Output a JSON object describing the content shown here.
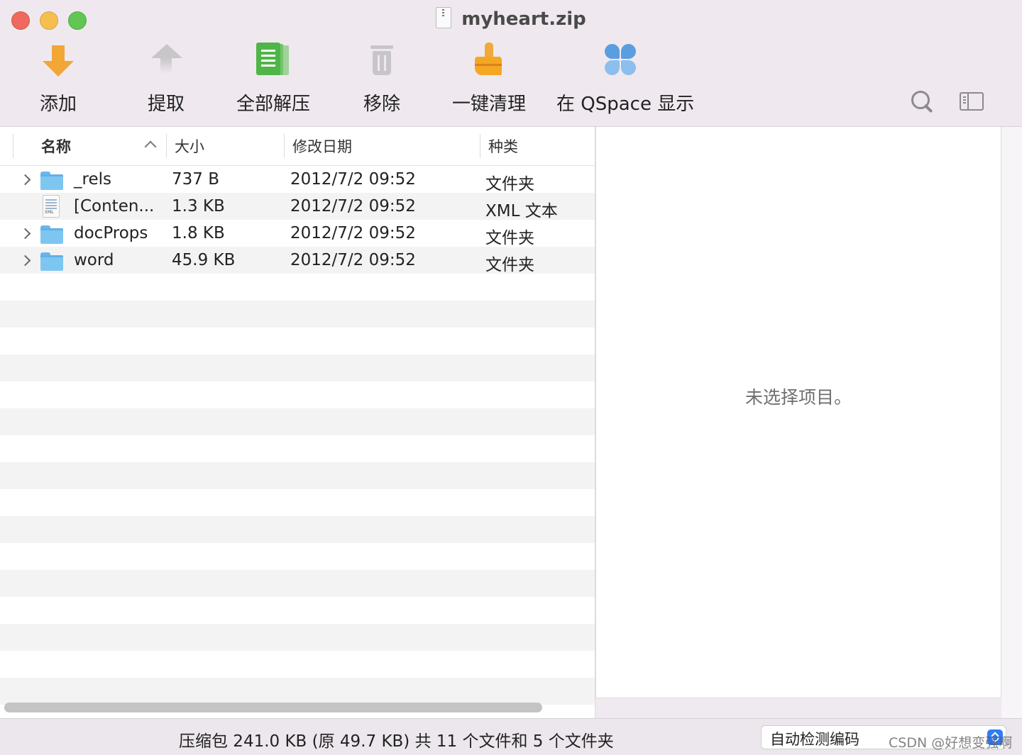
{
  "window": {
    "title": "myheart.zip"
  },
  "toolbar": {
    "add": "添加",
    "extract": "提取",
    "extract_all": "全部解压",
    "remove": "移除",
    "one_click_clean": "一键清理",
    "show_in_qspace": "在 QSpace 显示"
  },
  "columns": {
    "name": "名称",
    "size": "大小",
    "modified": "修改日期",
    "kind": "种类"
  },
  "files": [
    {
      "name": "_rels",
      "size": "737 B",
      "modified": "2012/7/2 09:52",
      "kind": "文件夹",
      "type": "folder"
    },
    {
      "name": "[Conten...",
      "size": "1.3 KB",
      "modified": "2012/7/2 09:52",
      "kind": "XML 文本",
      "type": "xml"
    },
    {
      "name": "docProps",
      "size": "1.8 KB",
      "modified": "2012/7/2 09:52",
      "kind": "文件夹",
      "type": "folder"
    },
    {
      "name": "word",
      "size": "45.9 KB",
      "modified": "2012/7/2 09:52",
      "kind": "文件夹",
      "type": "folder"
    }
  ],
  "preview": {
    "empty_message": "未选择项目。"
  },
  "status": {
    "summary": "压缩包 241.0 KB (原 49.7 KB) 共 11 个文件和 5 个文件夹",
    "encoding": "自动检测编码"
  },
  "watermark": "CSDN @好想变强啊",
  "colors": {
    "close": "#ee6a5f",
    "minimize": "#f4bf4f",
    "maximize": "#62c554",
    "add_icon": "#f1a636",
    "extract_all_icon": "#4fb548",
    "qspace_icon": "#5a9ee0",
    "folder": "#7ec6f2"
  }
}
